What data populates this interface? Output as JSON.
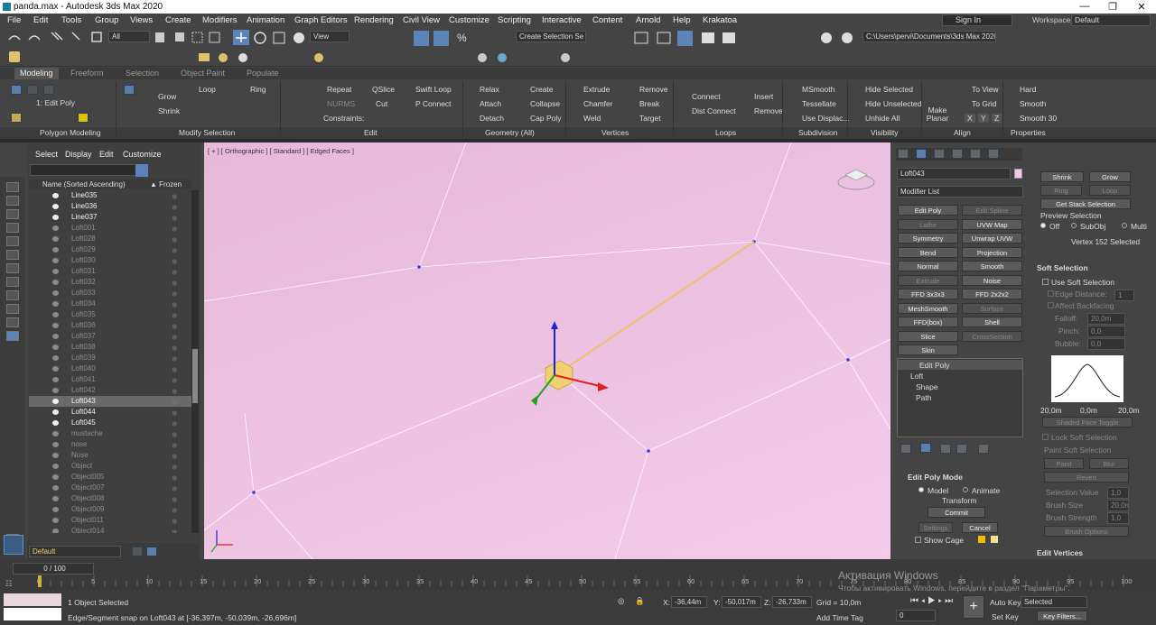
{
  "window": {
    "title": "panda.max - Autodesk 3ds Max 2020",
    "minimize": "—",
    "restore": "❐",
    "close": "✕"
  },
  "menu": [
    "File",
    "Edit",
    "Tools",
    "Group",
    "Views",
    "Create",
    "Modifiers",
    "Animation",
    "Graph Editors",
    "Rendering",
    "Civil View",
    "Customize",
    "Scripting",
    "Interactive",
    "Content",
    "Arnold",
    "Help",
    "Krakatoa"
  ],
  "account": {
    "sign_in": "Sign In",
    "workspaces_label": "Workspaces:",
    "workspaces_value": "Default"
  },
  "toolbar": {
    "filter": "All",
    "ref_coord": "View",
    "named_selection": "Create Selection Se",
    "project_path": "C:\\Users\\pervi\\Documents\\3ds Max 2020"
  },
  "tabs": [
    "Modeling",
    "Freeform",
    "Selection",
    "Object Paint",
    "Populate"
  ],
  "ribbon": {
    "polygon_modeling": {
      "title": "Polygon Modeling",
      "mode": "1: Edit Poly"
    },
    "modify_selection": {
      "title": "Modify Selection",
      "grow": "Grow",
      "shrink": "Shrink",
      "loop": "Loop",
      "ring": "Ring"
    },
    "edit": {
      "title": "Edit",
      "repeat": "Repeat",
      "qslice": "QSlice",
      "swift_loop": "Swift Loop",
      "nurms": "NURMS",
      "cut": "Cut",
      "p_connect": "P Connect",
      "constraints": "Constraints:"
    },
    "geometry": {
      "title": "Geometry (All)",
      "relax": "Relax",
      "create": "Create",
      "attach": "Attach",
      "collapse": "Collapse",
      "detach": "Detach",
      "cap_poly": "Cap Poly"
    },
    "vertices": {
      "title": "Vertices",
      "extrude": "Extrude",
      "remove": "Remove",
      "chamfer": "Chamfer",
      "break": "Break",
      "weld": "Weld",
      "target": "Target"
    },
    "loops": {
      "title": "Loops",
      "connect": "Connect",
      "insert": "Insert",
      "dist_connect": "Dist Connect",
      "remove": "Remove"
    },
    "subdivision": {
      "title": "Subdivision",
      "msmooth": "MSmooth",
      "tessellate": "Tessellate",
      "use_displac": "Use Displac..."
    },
    "visibility": {
      "title": "Visibility",
      "hide_selected": "Hide Selected",
      "hide_unselected": "Hide Unselected",
      "unhide_all": "Unhide All"
    },
    "align": {
      "title": "Align",
      "make_planar": "Make Planar",
      "to_view": "To View",
      "to_grid": "To Grid",
      "x": "X",
      "y": "Y",
      "z": "Z"
    },
    "properties": {
      "title": "Properties",
      "hard": "Hard",
      "smooth": "Smooth",
      "smooth30": "Smooth 30"
    }
  },
  "scene_explorer": {
    "menu": [
      "Select",
      "Display",
      "Edit",
      "Customize"
    ],
    "col_name": "Name (Sorted Ascending)",
    "col_frozen": "▲ Frozen",
    "items": [
      {
        "name": "Line035",
        "visible": true,
        "selected": false
      },
      {
        "name": "Line036",
        "visible": true,
        "selected": false
      },
      {
        "name": "Line037",
        "visible": true,
        "selected": false
      },
      {
        "name": "Loft001",
        "visible": false,
        "selected": false
      },
      {
        "name": "Loft028",
        "visible": false,
        "selected": false
      },
      {
        "name": "Loft029",
        "visible": false,
        "selected": false
      },
      {
        "name": "Loft030",
        "visible": false,
        "selected": false
      },
      {
        "name": "Loft031",
        "visible": false,
        "selected": false
      },
      {
        "name": "Loft032",
        "visible": false,
        "selected": false
      },
      {
        "name": "Loft033",
        "visible": false,
        "selected": false
      },
      {
        "name": "Loft034",
        "visible": false,
        "selected": false
      },
      {
        "name": "Loft035",
        "visible": false,
        "selected": false
      },
      {
        "name": "Loft036",
        "visible": false,
        "selected": false
      },
      {
        "name": "Loft037",
        "visible": false,
        "selected": false
      },
      {
        "name": "Loft038",
        "visible": false,
        "selected": false
      },
      {
        "name": "Loft039",
        "visible": false,
        "selected": false
      },
      {
        "name": "Loft040",
        "visible": false,
        "selected": false
      },
      {
        "name": "Loft041",
        "visible": false,
        "selected": false
      },
      {
        "name": "Loft042",
        "visible": false,
        "selected": false
      },
      {
        "name": "Loft043",
        "visible": true,
        "selected": true
      },
      {
        "name": "Loft044",
        "visible": true,
        "selected": false
      },
      {
        "name": "Loft045",
        "visible": true,
        "selected": false
      },
      {
        "name": "mustache",
        "visible": false,
        "selected": false
      },
      {
        "name": "nose",
        "visible": false,
        "selected": false
      },
      {
        "name": "Nose",
        "visible": false,
        "selected": false
      },
      {
        "name": "Object",
        "visible": false,
        "selected": false
      },
      {
        "name": "Object005",
        "visible": false,
        "selected": false
      },
      {
        "name": "Object007",
        "visible": false,
        "selected": false
      },
      {
        "name": "Object008",
        "visible": false,
        "selected": false
      },
      {
        "name": "Object009",
        "visible": false,
        "selected": false
      },
      {
        "name": "Object011",
        "visible": false,
        "selected": false
      },
      {
        "name": "Object014",
        "visible": false,
        "selected": false
      }
    ],
    "layer": "Default"
  },
  "viewport": {
    "label": "[ + ] [ Orthographic ] [ Standard ] [ Edged Faces ]",
    "axis_x": "x",
    "axis_y": "y",
    "axis_z": "z"
  },
  "command_panel": {
    "object_name": "Loft043",
    "modifier_list": "Modifier List",
    "buttons": [
      {
        "label": "Edit Poly",
        "enabled": true
      },
      {
        "label": "Edit Spline",
        "enabled": false
      },
      {
        "label": "Lathe",
        "enabled": false
      },
      {
        "label": "UVW Map",
        "enabled": true
      },
      {
        "label": "Symmetry",
        "enabled": true
      },
      {
        "label": "Unwrap UVW",
        "enabled": true
      },
      {
        "label": "Bend",
        "enabled": true
      },
      {
        "label": "Projection",
        "enabled": true
      },
      {
        "label": "Normal",
        "enabled": true
      },
      {
        "label": "Smooth",
        "enabled": true
      },
      {
        "label": "Extrude",
        "enabled": false
      },
      {
        "label": "Noise",
        "enabled": true
      },
      {
        "label": "FFD 3x3x3",
        "enabled": true
      },
      {
        "label": "FFD 2x2x2",
        "enabled": true
      },
      {
        "label": "MeshSmooth",
        "enabled": true
      },
      {
        "label": "Surface",
        "enabled": false
      },
      {
        "label": "FFD(box)",
        "enabled": true
      },
      {
        "label": "Shell",
        "enabled": true
      },
      {
        "label": "Slice",
        "enabled": true
      },
      {
        "label": "CrossSection",
        "enabled": false
      },
      {
        "label": "Skin",
        "enabled": true
      }
    ],
    "stack": [
      "Edit Poly",
      "Loft",
      "Shape",
      "Path"
    ],
    "edit_poly_mode": {
      "title": "Edit Poly Mode",
      "model": "Model",
      "animate": "Animate",
      "transform": "Transform",
      "commit": "Commit",
      "settings": "Settings",
      "cancel": "Cancel",
      "show_cage": "Show Cage"
    }
  },
  "right_panel": {
    "shrink": "Shrink",
    "grow": "Grow",
    "ring": "Ring",
    "loop": "Loop",
    "get_stack": "Get Stack Selection",
    "preview": "Preview Selection",
    "off": "Off",
    "subobj": "SubObj",
    "multi": "Multi",
    "status": "Vertex 152 Selected",
    "soft_sel": "Soft Selection",
    "use_soft": "Use Soft Selection",
    "edge_dist": "Edge Distance:",
    "edge_dist_val": "1",
    "affect_back": "Affect Backfacing",
    "falloff": "Falloff:",
    "falloff_val": "20,0m",
    "pinch": "Pinch:",
    "pinch_val": "0,0",
    "bubble": "Bubble:",
    "bubble_val": "0,0",
    "curve_left": "20,0m",
    "curve_mid": "0,0m",
    "curve_right": "20,0m",
    "shaded": "Shaded Face Toggle",
    "lock": "Lock Soft Selection",
    "paint_title": "Paint Soft Selection",
    "paint": "Paint",
    "blur": "Blur",
    "revert": "Revert",
    "sel_value": "Selection Value",
    "sel_value_val": "1,0",
    "brush_size": "Brush Size",
    "brush_size_val": "20,0m",
    "brush_strength": "Brush Strength",
    "brush_strength_val": "1,0",
    "brush_opts": "Brush Options",
    "edit_vertices": "Edit Vertices"
  },
  "timeline": {
    "frame": "0 / 100",
    "ticks": [
      "0",
      "5",
      "10",
      "15",
      "20",
      "25",
      "30",
      "35",
      "40",
      "45",
      "50",
      "55",
      "60",
      "65",
      "70",
      "75",
      "80",
      "85",
      "90",
      "95",
      "100"
    ]
  },
  "status": {
    "objects": "1 Object Selected",
    "prompt": "Edge/Segment snap on Loft043 at [-36,397m, -50,039m, -26,696m]",
    "x_label": "X:",
    "x": "-36,44m",
    "y_label": "Y:",
    "y": "-50,017m",
    "z_label": "Z:",
    "z": "-26,733m",
    "grid": "Grid = 10,0m",
    "add_time_tag": "Add Time Tag",
    "auto_key": "Auto Key",
    "selected": "Selected",
    "set_key": "Set Key",
    "key_filters": "Key Filters...",
    "frame_val": "0",
    "watermark1": "Активация Windows",
    "watermark2": "Чтобы активировать Windows, перейдите в раздел \"Параметры\"."
  }
}
